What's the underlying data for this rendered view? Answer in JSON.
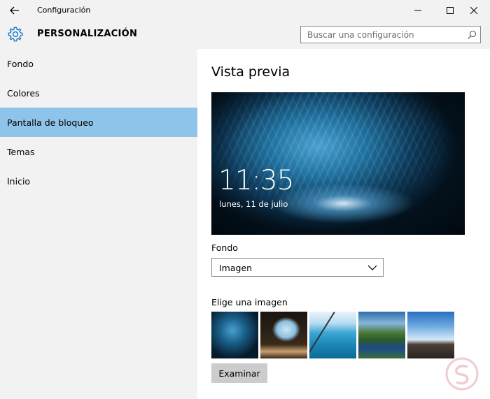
{
  "window": {
    "title": "Configuración",
    "controls": {
      "minimize": "minimize-icon",
      "maximize": "maximize-icon",
      "close": "close-icon"
    }
  },
  "header": {
    "icon": "gear-icon",
    "title": "PERSONALIZACIÓN",
    "search_placeholder": "Buscar una configuración"
  },
  "sidebar": {
    "items": [
      {
        "label": "Fondo",
        "active": false
      },
      {
        "label": "Colores",
        "active": false
      },
      {
        "label": "Pantalla de bloqueo",
        "active": true
      },
      {
        "label": "Temas",
        "active": false
      },
      {
        "label": "Inicio",
        "active": false
      }
    ]
  },
  "main": {
    "title": "Vista previa",
    "preview": {
      "time": "11:35",
      "date": "lunes, 11 de julio"
    },
    "background_label": "Fondo",
    "background_value": "Imagen",
    "choose_label": "Elige una imagen",
    "browse_label": "Examinar"
  },
  "colors": {
    "accent": "#8ec4ea",
    "background": "#f2f2f2",
    "content": "#ffffff",
    "button": "#cccccc"
  }
}
